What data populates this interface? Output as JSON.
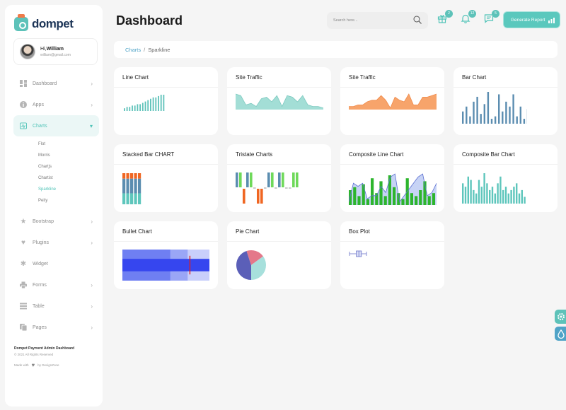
{
  "brand": {
    "name": "dompet"
  },
  "user": {
    "greeting": "Hi,",
    "name": "William",
    "email": "william@gmail.com"
  },
  "sidebar": {
    "items": [
      {
        "label": "Dashboard",
        "icon": "grid-icon",
        "has_children": true
      },
      {
        "label": "Apps",
        "icon": "info-icon",
        "has_children": true
      },
      {
        "label": "Charts",
        "icon": "chart-icon",
        "has_children": true,
        "active": true,
        "children": [
          "Flot",
          "Morris",
          "Chartjs",
          "Chartist",
          "Sparkline",
          "Peity"
        ],
        "selected_child": "Sparkline"
      },
      {
        "label": "Bootstrap",
        "icon": "star-icon",
        "has_children": true
      },
      {
        "label": "Plugins",
        "icon": "heart-icon",
        "has_children": true
      },
      {
        "label": "Widget",
        "icon": "settings-icon",
        "has_children": false
      },
      {
        "label": "Forms",
        "icon": "printer-icon",
        "has_children": true
      },
      {
        "label": "Table",
        "icon": "table-icon",
        "has_children": true
      },
      {
        "label": "Pages",
        "icon": "copy-icon",
        "has_children": true
      }
    ],
    "footer": {
      "title": "Dompet Payment Admin Dashboard",
      "copyright": "© 2021 All Rights Reserved",
      "made_with": "Made with",
      "by": "by DexignZone"
    }
  },
  "header": {
    "title": "Dashboard",
    "search_placeholder": "Search here...",
    "badges": {
      "gift": "2",
      "bell": "12",
      "chat": "5"
    },
    "generate_label": "Generate Report"
  },
  "breadcrumb": {
    "parent": "Charts",
    "separator": "/",
    "current": "Sparkline"
  },
  "cards": {
    "line_chart": "Line Chart",
    "site_traffic_1": "Site Traffic",
    "site_traffic_2": "Site Traffic",
    "bar_chart": "Bar Chart",
    "stacked_bar": "Stacked Bar CHART",
    "tristate": "Tristate Charts",
    "composite_line": "Composite Line Chart",
    "composite_bar": "Composite Bar Chart",
    "bullet": "Bullet Chart",
    "pie": "Pie Chart",
    "box_plot": "Box Plot"
  },
  "colors": {
    "accent": "#5dc2b9",
    "traffic_1": "#a3ded6",
    "traffic_2": "#f7a46b",
    "bar": "#5b8db0",
    "stack_top": "#f06622",
    "stack_mid": "#5b8db0",
    "stack_low": "#5ec6bc",
    "tristate_pos": "#6fd95a",
    "tristate_neg": "#f06622",
    "tristate_mid": "#5b8db0",
    "composite_bar": "#2db52d",
    "composite_fill": "#c7d3f5",
    "composite_line": "#5b6fd1",
    "composite_bar_2": "#5ec6bc",
    "bullet_range": [
      "#c9cffb",
      "#9aa6f6",
      "#6f7ff2"
    ],
    "bullet_bar": "#3646ef",
    "bullet_target": "#e02020",
    "pie": [
      "#5b5fb8",
      "#e4788a",
      "#a7e0dc"
    ]
  },
  "chart_data": [
    {
      "type": "bar",
      "id": "line_chart",
      "values": [
        2,
        3,
        3,
        4,
        4,
        5,
        5,
        6,
        7,
        8,
        9,
        10,
        10,
        11,
        12,
        12
      ]
    },
    {
      "type": "area",
      "id": "site_traffic_1",
      "values": [
        10,
        9,
        3,
        4,
        2,
        7,
        8,
        5,
        9,
        2,
        9,
        8,
        5,
        9,
        3,
        2,
        2,
        1
      ]
    },
    {
      "type": "area",
      "id": "site_traffic_2",
      "values": [
        2,
        2,
        3,
        3,
        5,
        6,
        6,
        9,
        6,
        1,
        8,
        6,
        5,
        10,
        3,
        3,
        8,
        8,
        9,
        10
      ]
    },
    {
      "type": "bar",
      "id": "bar_chart",
      "values": [
        5,
        7,
        3,
        9,
        11,
        4,
        8,
        13,
        2,
        3,
        12,
        5,
        9,
        7,
        12,
        3,
        7,
        2,
        6
      ]
    },
    {
      "type": "bar",
      "id": "stacked_bar",
      "stacked": true,
      "values": [
        [
          3,
          8,
          6
        ],
        [
          3,
          8,
          6
        ],
        [
          3,
          8,
          6
        ],
        [
          3,
          8,
          6
        ],
        [
          3,
          8,
          6
        ]
      ]
    },
    {
      "type": "bar",
      "id": "tristate",
      "values": [
        1,
        1,
        -1,
        1,
        1,
        0,
        -1,
        -1,
        0,
        1,
        1,
        0,
        1,
        1,
        0,
        0,
        1,
        1
      ]
    },
    {
      "type": "bar",
      "id": "composite_line_bars",
      "values": [
        5,
        6,
        3,
        7,
        2,
        9,
        4,
        8,
        3,
        10,
        6,
        4,
        2,
        9,
        4,
        3,
        5,
        8,
        3,
        4
      ]
    },
    {
      "type": "line",
      "id": "composite_line_line",
      "values": [
        1,
        7,
        6,
        7,
        2,
        3,
        3,
        6,
        4,
        9,
        10,
        1,
        3,
        5,
        7,
        9,
        10,
        3,
        4,
        7
      ]
    },
    {
      "type": "bar",
      "id": "composite_bar",
      "values": [
        6,
        5,
        8,
        7,
        4,
        3,
        7,
        5,
        9,
        6,
        4,
        5,
        3,
        6,
        8,
        4,
        5,
        3,
        4,
        5,
        6,
        3,
        4,
        2
      ]
    },
    {
      "type": "bullet",
      "id": "bullet",
      "ranges": [
        100,
        75,
        55
      ],
      "value": 100,
      "target": 77
    },
    {
      "type": "pie",
      "id": "pie",
      "values": [
        45,
        20,
        35
      ]
    },
    {
      "type": "box",
      "id": "box_plot",
      "min": 0,
      "q1": 4,
      "median": 5.5,
      "q3": 7,
      "max": 10
    }
  ],
  "floating": {
    "settings_color": "#5dc2b9",
    "theme_color": "#4fa3c7"
  }
}
